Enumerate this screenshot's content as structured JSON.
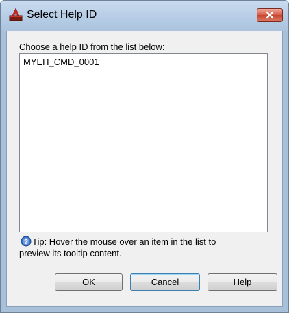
{
  "window": {
    "title": "Select Help ID"
  },
  "dialog": {
    "prompt": "Choose a help ID from the list below:",
    "list_items": [
      "MYEH_CMD_0001"
    ],
    "tip_line1": "Tip: Hover the mouse over an item in the list to",
    "tip_line2": "preview its tooltip content."
  },
  "buttons": {
    "ok": "OK",
    "cancel": "Cancel",
    "help": "Help"
  },
  "icons": {
    "app": "autocad-a-icon",
    "close": "close-icon",
    "tip": "info-tip-icon"
  },
  "colors": {
    "titlebar": "#b7cde6",
    "close_button": "#d65a45",
    "client_background": "#f0f0f0",
    "list_background": "#ffffff",
    "focused_button_border": "#3c7fb1"
  }
}
